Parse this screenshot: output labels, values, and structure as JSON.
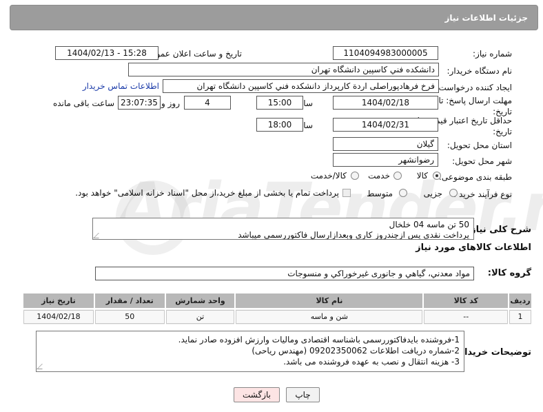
{
  "header": {
    "title": "جزئیات اطلاعات نیاز"
  },
  "form": {
    "need_number": {
      "label": "شماره نیاز:",
      "value": "1104094983000005"
    },
    "announce_datetime": {
      "label": "تاریخ و ساعت اعلان عمومی:",
      "value": "1404/02/13 - 15:28"
    },
    "buyer_org": {
      "label": "نام دستگاه خریدار:",
      "value": "دانشکده فني کاسپين دانشگاه تهران"
    },
    "requester": {
      "label": "ایجاد کننده درخواست:",
      "value": "فرخ فرهادپوراصلی اردة کارپرداز دانشکده فني کاسپين دانشگاه تهران",
      "contact_link": "اطلاعات تماس خریدار"
    },
    "reply_deadline": {
      "label": "مهلت ارسال پاسخ: تا تاریخ:",
      "date": "1404/02/18",
      "time_label": "ساعت",
      "time": "15:00",
      "days": "4",
      "days_label": "روز و",
      "remaining": "23:07:35",
      "remaining_label": "ساعت باقی مانده"
    },
    "price_validity": {
      "label": "حداقل تاریخ اعتبار قیمت: تا تاریخ:",
      "date": "1404/02/31",
      "time_label": "ساعت",
      "time": "18:00"
    },
    "province": {
      "label": "استان محل تحویل:",
      "value": "گیلان"
    },
    "city": {
      "label": "شهر محل تحویل:",
      "value": "رضوانشهر"
    },
    "category": {
      "label": "طبقه بندی موضوعی:",
      "options": [
        "کالا",
        "خدمت",
        "کالا/خدمت"
      ],
      "selected": "کالا"
    },
    "purchase_type": {
      "label": "نوع فرآیند خرید :",
      "options": [
        "جزیی",
        "متوسط"
      ],
      "selected": "",
      "payment_note": "پرداخت تمام یا بخشی از مبلغ خرید،از محل \"اسناد خزانه اسلامی\" خواهد بود."
    },
    "description": {
      "label": "شرح کلی نیاز:",
      "line1": "50 تن ماسه 04 خلخال",
      "line2": "پرداخت نقدی پس ازچندروز کاری وبعدازارسال فاکتوررسمی میباشد"
    }
  },
  "goods_section": {
    "title": "اطلاعات کالاهای مورد نیاز",
    "group_label": "گروه کالا:",
    "group_value": "مواد معدني، گیاهي و جانوری غیرخوراکي و منسوجات",
    "table": {
      "headers": [
        "ردیف",
        "کد کالا",
        "نام کالا",
        "واحد شمارش",
        "تعداد / مقدار",
        "تاریخ نیاز"
      ],
      "rows": [
        [
          "1",
          "--",
          "شن و ماسه",
          "تن",
          "50",
          "1404/02/18"
        ]
      ]
    }
  },
  "buyer_notes": {
    "label": "توضیحات خریدار:",
    "line1": "1-فروشنده بایدفاکتوررسمی باشناسه اقتصادی وماليات وارزش افزوده صادر نماید.",
    "line2": "2-شماره دريافت اطلاعات 09202350062 (مهندس رياحی)",
    "line3": "3- هزينه انتقال و نصب به عهده فروشنده می باشد."
  },
  "buttons": {
    "print": "چاپ",
    "back": "بازگشت"
  },
  "watermark": {
    "text": "AriaTender.neT"
  }
}
